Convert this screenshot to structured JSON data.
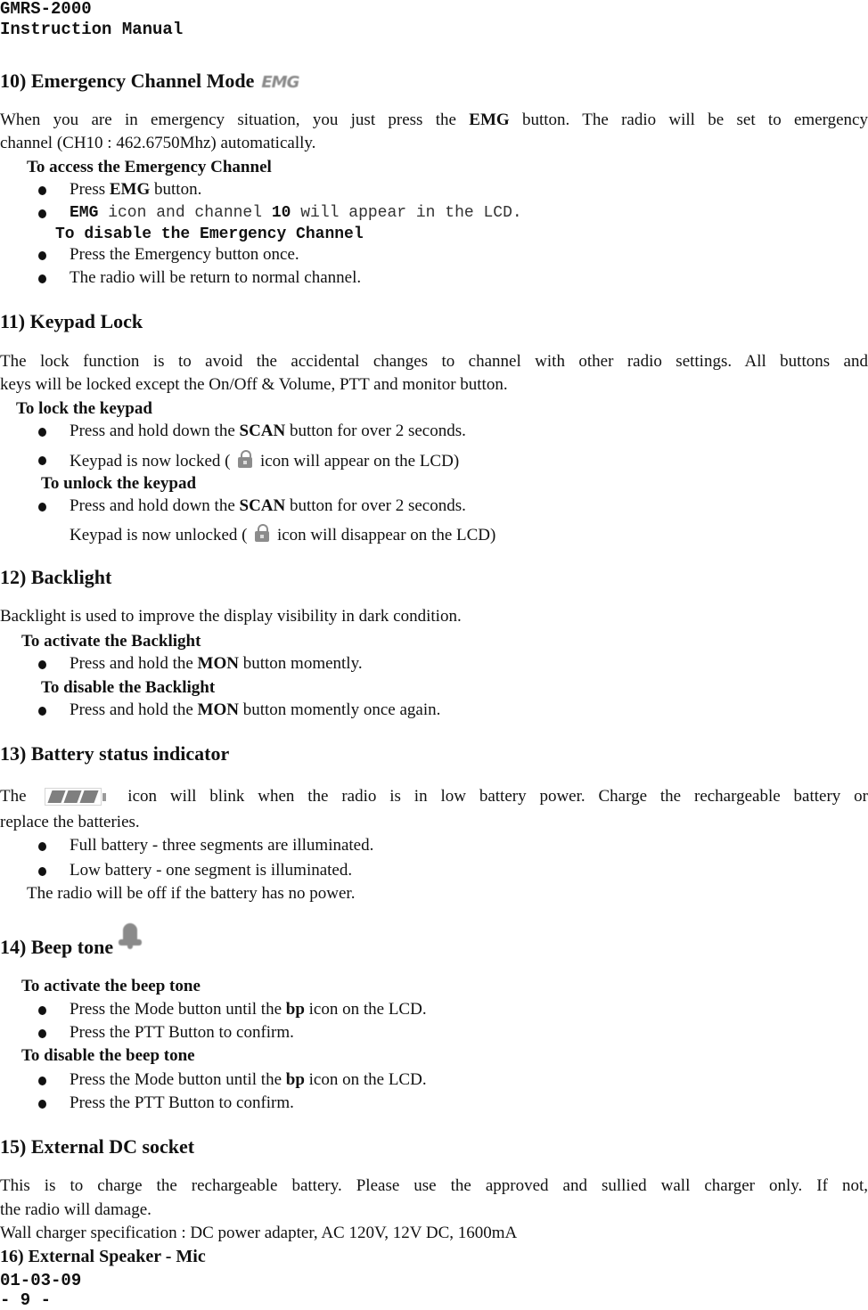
{
  "header": {
    "model": "GMRS-2000",
    "doc_title": "Instruction Manual"
  },
  "sections": {
    "s10": {
      "heading": "10)  Emergency Channel Mode",
      "heading_icon": "emg-icon",
      "heading_icon_text": "EMG",
      "para_l1_a": "When you are in emergency situation, you just press the ",
      "para_l1_b": "EMG",
      "para_l1_c": " button. The radio will be set to emergency",
      "para_l2": "channel (CH10 : 462.6750Mhz) automatically.",
      "sub1": "To access the Emergency Channel",
      "b1_a": "Press ",
      "b1_b": "EMG",
      "b1_c": " button.",
      "b2_a": "EMG",
      "b2_b": " icon and channel ",
      "b2_c": "10",
      "b2_d": " will appear in the LCD.",
      "sub2": "To disable the Emergency Channel",
      "b3": "Press the Emergency button once.",
      "b4": "The radio will be return to normal channel."
    },
    "s11": {
      "heading": "11)  Keypad Lock",
      "para_l1": "The lock function is to avoid the accidental changes to channel with other radio settings. All buttons and",
      "para_l2": "keys will be locked except the On/Off & Volume, PTT and monitor button.",
      "sub1": "To lock the keypad",
      "b1_a": "Press and hold down the ",
      "b1_b": "SCAN",
      "b1_c": " button for over 2 seconds.",
      "b2_a": "Keypad is now locked ( ",
      "b2_icon": "lock-icon",
      "b2_b": " icon will appear on the LCD)",
      "sub2": "To unlock the keypad",
      "b3_a": "Press and hold down the ",
      "b3_b": "SCAN",
      "b3_c": " button for over 2 seconds.",
      "b4_a": "Keypad is now unlocked ( ",
      "b4_icon": "lock-icon",
      "b4_b": " icon will disappear on the LCD)"
    },
    "s12": {
      "heading": "12)  Backlight",
      "para": "Backlight is used to improve the display visibility in dark condition.",
      "sub1": "To activate the Backlight",
      "b1_a": "Press and hold the ",
      "b1_b": "MON",
      "b1_c": " button momently.",
      "sub2": "To disable the Backlight",
      "b2_a": "Press and hold the ",
      "b2_b": "MON",
      "b2_c": " button momently once again."
    },
    "s13": {
      "heading": "13)  Battery status indicator",
      "para_l1_a": "The",
      "para_icon": "battery-icon",
      "para_l1_b": "icon will blink when the radio is in low battery power. Charge the rechargeable battery or",
      "para_l2": "replace the batteries.",
      "b1": "Full battery - three segments are illuminated.",
      "b2": "Low battery - one segment is illuminated.",
      "note": "The radio will be off if the battery has no power."
    },
    "s14": {
      "heading": "14)  Beep tone",
      "heading_icon": "bell-icon",
      "sub1": "To activate the beep tone",
      "b1_a": "Press the Mode button until the ",
      "b1_b": "bp",
      "b1_c": " icon on the LCD.",
      "b2": "Press the PTT Button to confirm.",
      "sub2": "To disable the beep tone",
      "b3_a": "Press the Mode button until the ",
      "b3_b": "bp",
      "b3_c": " icon on the LCD.",
      "b4": "Press the PTT Button to confirm."
    },
    "s15": {
      "heading": "15)  External DC socket",
      "para_l1": "This is to charge the rechargeable battery. Please use the approved and sullied wall charger only. If not,",
      "para_l2": "the radio will damage.",
      "spec": "Wall charger specification : DC power adapter, AC 120V, 12V DC, 1600mA"
    },
    "s16": {
      "heading": "16) External Speaker - Mic"
    }
  },
  "footer": {
    "date": "01-03-09",
    "page": "- 9 -"
  }
}
